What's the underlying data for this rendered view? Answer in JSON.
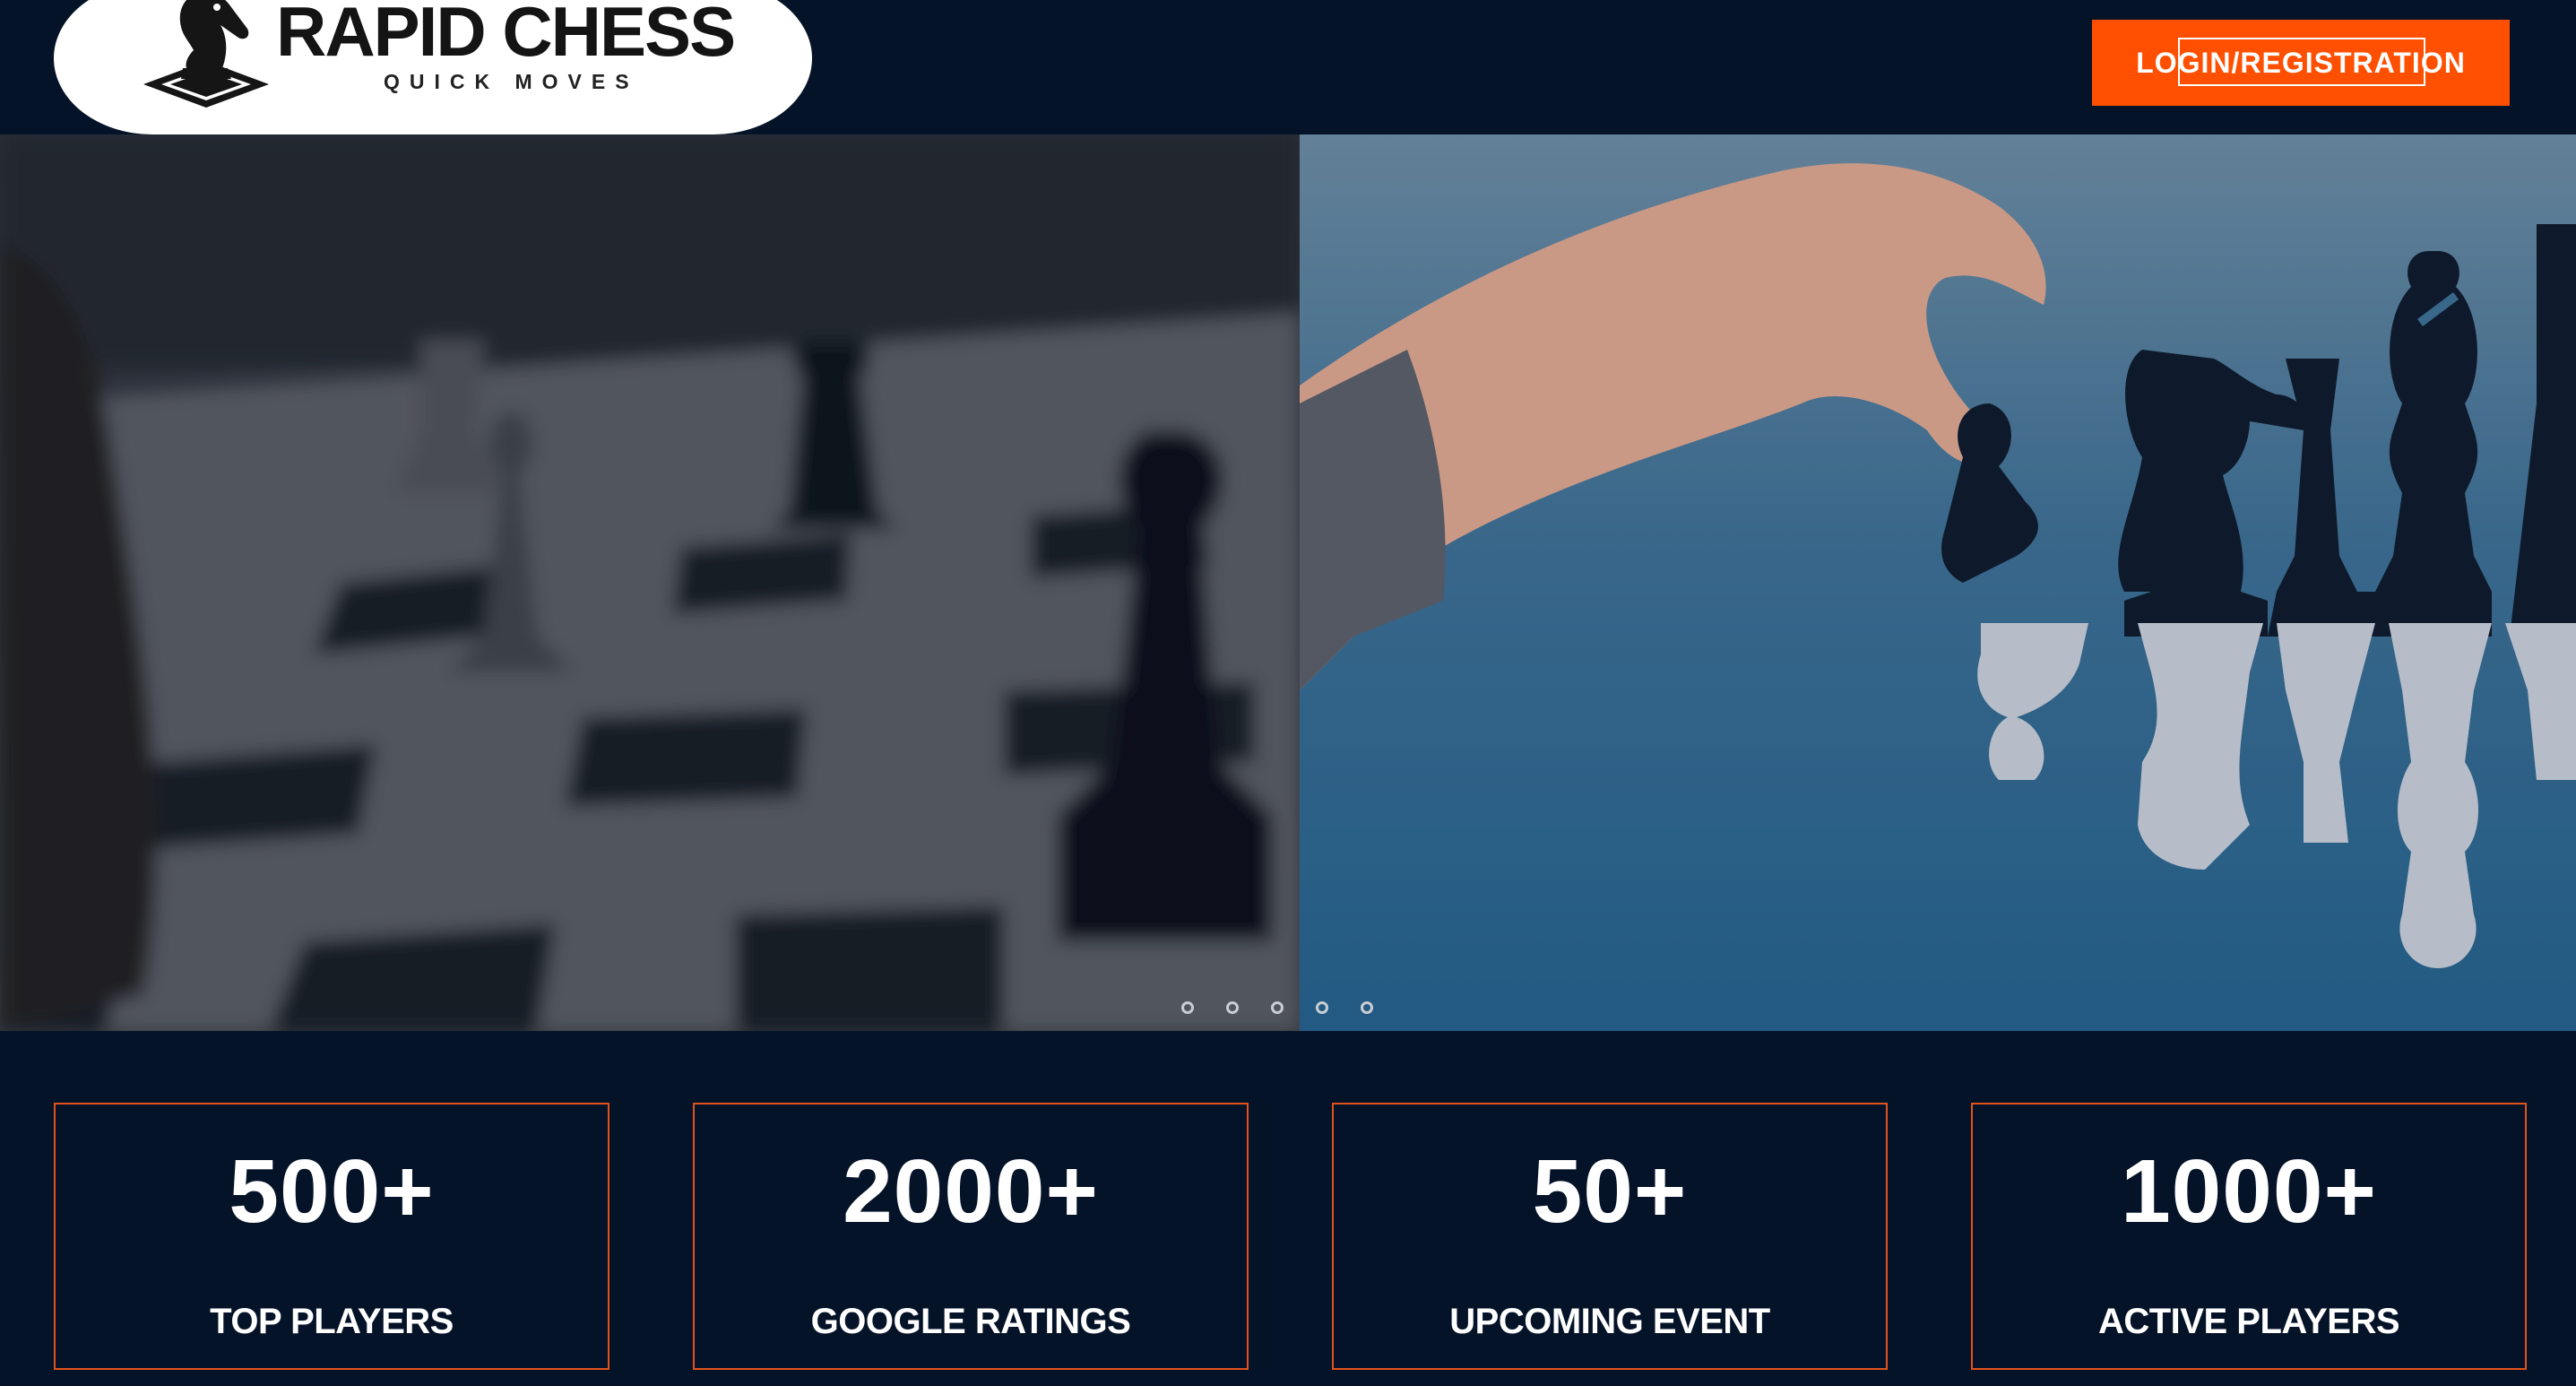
{
  "header": {
    "logo_title": "RAPID CHESS",
    "logo_subtitle": "QUICK MOVES",
    "logo_icon": "knight-icon",
    "login_label": "LOGIN/REGISTRATION"
  },
  "colors": {
    "background": "#051328",
    "accent": "#ff4f00",
    "card_border": "#e2531b"
  },
  "hero": {
    "slides": [
      "blurred-chessboard-slide",
      "hand-moving-chess-piece-slide"
    ],
    "dots_count": 5
  },
  "stats": [
    {
      "value": "500+",
      "label": "TOP PLAYERS"
    },
    {
      "value": "2000+",
      "label": "GOOGLE RATINGS"
    },
    {
      "value": "50+",
      "label": "UPCOMING EVENT"
    },
    {
      "value": "1000+",
      "label": "ACTIVE PLAYERS"
    }
  ]
}
